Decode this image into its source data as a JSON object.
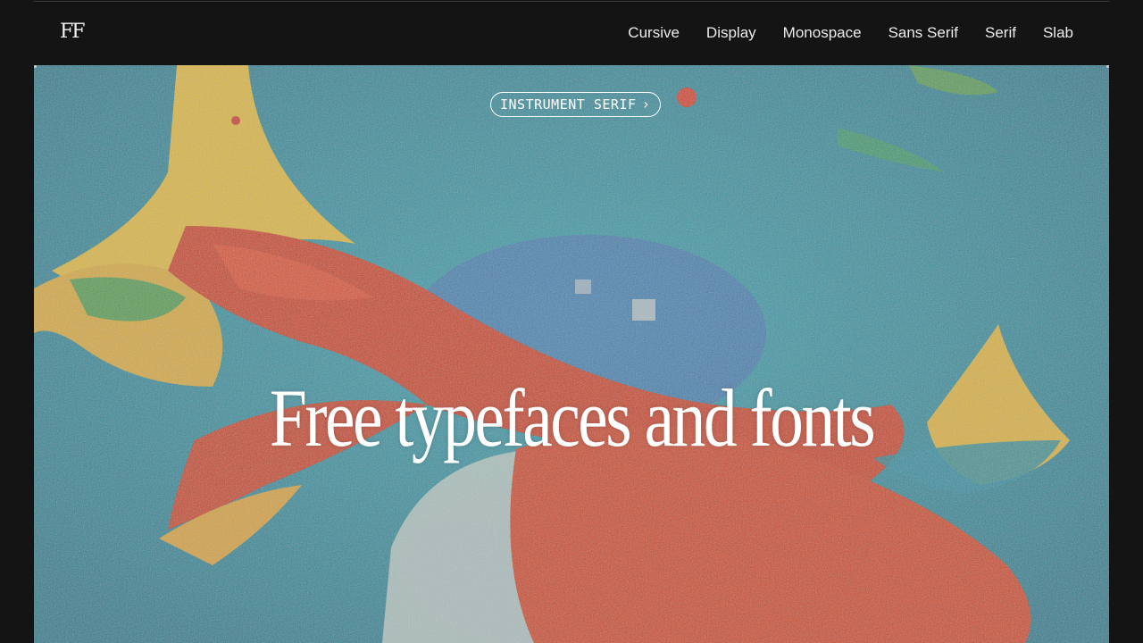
{
  "header": {
    "logo": "FF",
    "nav": [
      {
        "label": "Cursive"
      },
      {
        "label": "Display"
      },
      {
        "label": "Monospace"
      },
      {
        "label": "Sans Serif"
      },
      {
        "label": "Serif"
      },
      {
        "label": "Slab"
      }
    ]
  },
  "hero": {
    "badge_label": "INSTRUMENT SERIF",
    "badge_icon": "chevron-right-icon",
    "headline": "Free typefaces and fonts"
  },
  "colors": {
    "background": "#141414",
    "text": "#ffffff",
    "art_teal": "#2f8f9e",
    "art_orange": "#c8461a",
    "art_yellow": "#d6b43a"
  }
}
